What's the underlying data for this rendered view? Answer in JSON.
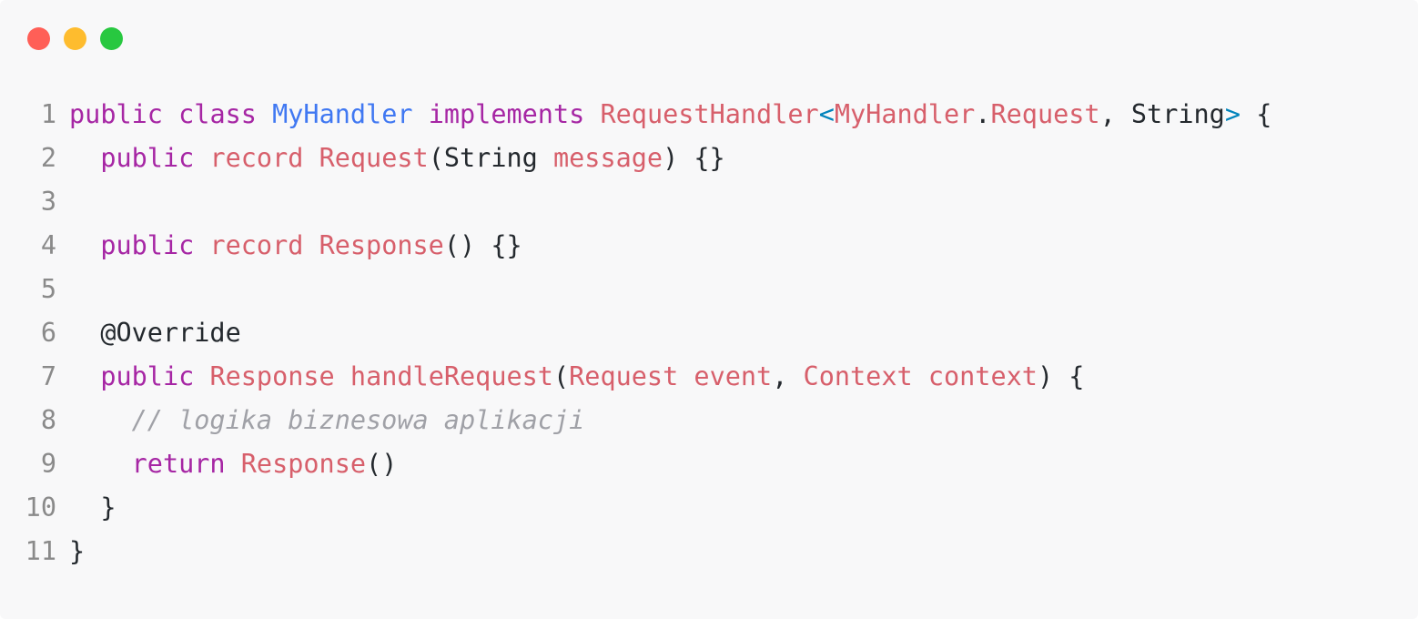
{
  "window": {
    "controls": [
      "close",
      "minimize",
      "maximize"
    ],
    "colors": {
      "close": "#ff5f57",
      "minimize": "#febc2e",
      "maximize": "#28c840",
      "background": "#f8f8f9"
    }
  },
  "code": {
    "language": "java",
    "lines": [
      {
        "number": "1",
        "tokens": [
          {
            "t": "public",
            "k": "kw"
          },
          {
            "t": " ",
            "k": "plain"
          },
          {
            "t": "class",
            "k": "kw"
          },
          {
            "t": " ",
            "k": "plain"
          },
          {
            "t": "MyHandler",
            "k": "cls"
          },
          {
            "t": " ",
            "k": "plain"
          },
          {
            "t": "implements",
            "k": "kw"
          },
          {
            "t": " ",
            "k": "plain"
          },
          {
            "t": "RequestHandler",
            "k": "ty"
          },
          {
            "t": "<",
            "k": "br"
          },
          {
            "t": "MyHandler",
            "k": "ty"
          },
          {
            "t": ".",
            "k": "plain"
          },
          {
            "t": "Request",
            "k": "ty"
          },
          {
            "t": ", String",
            "k": "plain"
          },
          {
            "t": ">",
            "k": "br"
          },
          {
            "t": " {",
            "k": "plain"
          }
        ]
      },
      {
        "number": "2",
        "tokens": [
          {
            "t": "  ",
            "k": "plain"
          },
          {
            "t": "public",
            "k": "kw"
          },
          {
            "t": " ",
            "k": "plain"
          },
          {
            "t": "record",
            "k": "ty"
          },
          {
            "t": " ",
            "k": "plain"
          },
          {
            "t": "Request",
            "k": "ty"
          },
          {
            "t": "(String ",
            "k": "plain"
          },
          {
            "t": "message",
            "k": "ty"
          },
          {
            "t": ") {}",
            "k": "plain"
          }
        ]
      },
      {
        "number": "3",
        "tokens": []
      },
      {
        "number": "4",
        "tokens": [
          {
            "t": "  ",
            "k": "plain"
          },
          {
            "t": "public",
            "k": "kw"
          },
          {
            "t": " ",
            "k": "plain"
          },
          {
            "t": "record",
            "k": "ty"
          },
          {
            "t": " ",
            "k": "plain"
          },
          {
            "t": "Response",
            "k": "ty"
          },
          {
            "t": "() {}",
            "k": "plain"
          }
        ]
      },
      {
        "number": "5",
        "tokens": []
      },
      {
        "number": "6",
        "tokens": [
          {
            "t": "  @Override",
            "k": "plain"
          }
        ]
      },
      {
        "number": "7",
        "tokens": [
          {
            "t": "  ",
            "k": "plain"
          },
          {
            "t": "public",
            "k": "kw"
          },
          {
            "t": " ",
            "k": "plain"
          },
          {
            "t": "Response",
            "k": "ty"
          },
          {
            "t": " ",
            "k": "plain"
          },
          {
            "t": "handleRequest",
            "k": "ty"
          },
          {
            "t": "(",
            "k": "plain"
          },
          {
            "t": "Request",
            "k": "ty"
          },
          {
            "t": " ",
            "k": "plain"
          },
          {
            "t": "event",
            "k": "ty"
          },
          {
            "t": ", ",
            "k": "plain"
          },
          {
            "t": "Context",
            "k": "ty"
          },
          {
            "t": " ",
            "k": "plain"
          },
          {
            "t": "context",
            "k": "ty"
          },
          {
            "t": ") {",
            "k": "plain"
          }
        ]
      },
      {
        "number": "8",
        "tokens": [
          {
            "t": "    ",
            "k": "plain"
          },
          {
            "t": "// logika biznesowa aplikacji",
            "k": "cm"
          }
        ]
      },
      {
        "number": "9",
        "tokens": [
          {
            "t": "    ",
            "k": "plain"
          },
          {
            "t": "return",
            "k": "kw"
          },
          {
            "t": " ",
            "k": "plain"
          },
          {
            "t": "Response",
            "k": "ty"
          },
          {
            "t": "()",
            "k": "plain"
          }
        ]
      },
      {
        "number": "10",
        "tokens": [
          {
            "t": "  }",
            "k": "plain"
          }
        ]
      },
      {
        "number": "11",
        "tokens": [
          {
            "t": "}",
            "k": "plain"
          }
        ]
      }
    ]
  }
}
